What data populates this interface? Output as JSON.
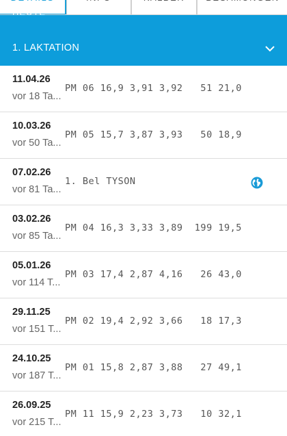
{
  "tabs": [
    {
      "label": "DETAILS",
      "active": true
    },
    {
      "label": "INFO",
      "active": false
    },
    {
      "label": "KÄLBER",
      "active": false
    },
    {
      "label": "BESAMUNGEN",
      "active": false
    }
  ],
  "header": {
    "cut_label": "HEUTE",
    "section_title": "1. LAKTATION",
    "accent_color": "#0d9ddb"
  },
  "rows": [
    {
      "date": "11.04.26",
      "ago": "vor 18 Ta...",
      "data": "PM 06 16,9 3,91 3,92   51 21,0",
      "icon": ""
    },
    {
      "date": "10.03.26",
      "ago": "vor 50 Ta...",
      "data": "PM 05 15,7 3,87 3,93   50 18,9",
      "icon": ""
    },
    {
      "date": "07.02.26",
      "ago": "vor 81 Ta...",
      "data": "1. Bel TYSON",
      "icon": "globe-icon"
    },
    {
      "date": "03.02.26",
      "ago": "vor 85 Ta...",
      "data": "PM 04 16,3 3,33 3,89  199 19,5",
      "icon": ""
    },
    {
      "date": "05.01.26",
      "ago": "vor 114 T...",
      "data": "PM 03 17,4 2,87 4,16   26 43,0",
      "icon": ""
    },
    {
      "date": "29.11.25",
      "ago": "vor 151 T...",
      "data": "PM 02 19,4 2,92 3,66   18 17,3",
      "icon": ""
    },
    {
      "date": "24.10.25",
      "ago": "vor 187 T...",
      "data": "PM 01 15,8 2,87 3,88   27 49,1",
      "icon": ""
    },
    {
      "date": "26.09.25",
      "ago": "vor 215 T...",
      "data": "PM 11 15,9 2,23 3,73   10 32,1",
      "icon": ""
    }
  ]
}
